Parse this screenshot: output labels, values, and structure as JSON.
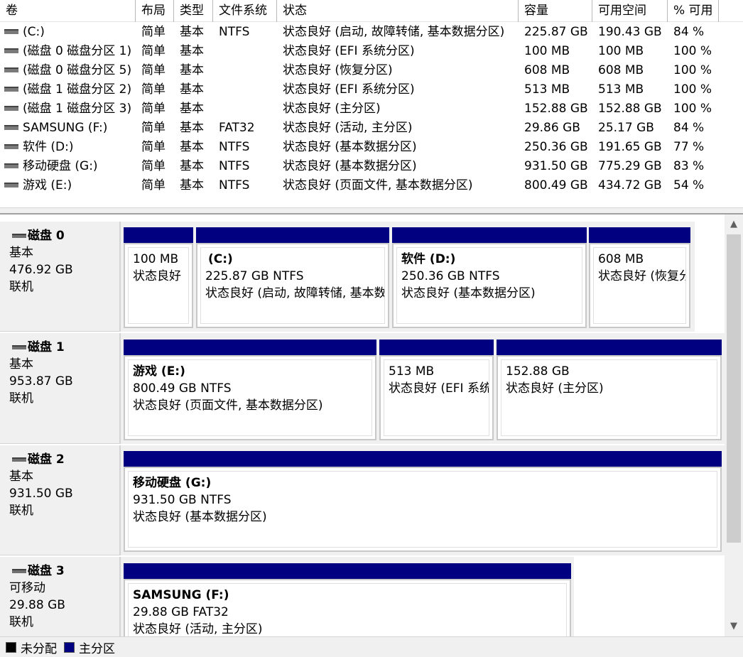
{
  "volume_list": {
    "columns": [
      "卷",
      "布局",
      "类型",
      "文件系统",
      "状态",
      "容量",
      "可用空间",
      "% 可用"
    ],
    "rows": [
      {
        "volume": "(C:)",
        "layout": "简单",
        "type": "基本",
        "fs": "NTFS",
        "status": "状态良好 (启动, 故障转储, 基本数据分区)",
        "capacity": "225.87 GB",
        "free": "190.43 GB",
        "pct": "84 %"
      },
      {
        "volume": "(磁盘 0 磁盘分区 1)",
        "layout": "简单",
        "type": "基本",
        "fs": "",
        "status": "状态良好 (EFI 系统分区)",
        "capacity": "100 MB",
        "free": "100 MB",
        "pct": "100 %"
      },
      {
        "volume": "(磁盘 0 磁盘分区 5)",
        "layout": "简单",
        "type": "基本",
        "fs": "",
        "status": "状态良好 (恢复分区)",
        "capacity": "608 MB",
        "free": "608 MB",
        "pct": "100 %"
      },
      {
        "volume": "(磁盘 1 磁盘分区 2)",
        "layout": "简单",
        "type": "基本",
        "fs": "",
        "status": "状态良好 (EFI 系统分区)",
        "capacity": "513 MB",
        "free": "513 MB",
        "pct": "100 %"
      },
      {
        "volume": "(磁盘 1 磁盘分区 3)",
        "layout": "简单",
        "type": "基本",
        "fs": "",
        "status": "状态良好 (主分区)",
        "capacity": "152.88 GB",
        "free": "152.88 GB",
        "pct": "100 %"
      },
      {
        "volume": "SAMSUNG (F:)",
        "layout": "简单",
        "type": "基本",
        "fs": "FAT32",
        "status": "状态良好 (活动, 主分区)",
        "capacity": "29.86 GB",
        "free": "25.17 GB",
        "pct": "84 %"
      },
      {
        "volume": "软件 (D:)",
        "layout": "简单",
        "type": "基本",
        "fs": "NTFS",
        "status": "状态良好 (基本数据分区)",
        "capacity": "250.36 GB",
        "free": "191.65 GB",
        "pct": "77 %"
      },
      {
        "volume": "移动硬盘 (G:)",
        "layout": "简单",
        "type": "基本",
        "fs": "NTFS",
        "status": "状态良好 (基本数据分区)",
        "capacity": "931.50 GB",
        "free": "775.29 GB",
        "pct": "83 %"
      },
      {
        "volume": "游戏 (E:)",
        "layout": "简单",
        "type": "基本",
        "fs": "NTFS",
        "status": "状态良好 (页面文件, 基本数据分区)",
        "capacity": "800.49 GB",
        "free": "434.72 GB",
        "pct": "54 %"
      }
    ]
  },
  "disks": [
    {
      "name": "磁盘 0",
      "kind": "基本",
      "size": "476.92 GB",
      "state": "联机",
      "partitions": [
        {
          "title": "",
          "size_fs": "100 MB",
          "status": "状态良好"
        },
        {
          "title": "(C:)",
          "size_fs": "225.87 GB NTFS",
          "status": "状态良好 (启动, 故障转储, 基本数据分区)"
        },
        {
          "title": "软件  (D:)",
          "size_fs": "250.36 GB NTFS",
          "status": "状态良好 (基本数据分区)"
        },
        {
          "title": "",
          "size_fs": "608 MB",
          "status": "状态良好 (恢复分区)"
        }
      ]
    },
    {
      "name": "磁盘 1",
      "kind": "基本",
      "size": "953.87 GB",
      "state": "联机",
      "partitions": [
        {
          "title": "游戏  (E:)",
          "size_fs": "800.49 GB NTFS",
          "status": "状态良好 (页面文件, 基本数据分区)"
        },
        {
          "title": "",
          "size_fs": "513 MB",
          "status": "状态良好 (EFI 系统分区)"
        },
        {
          "title": "",
          "size_fs": "152.88 GB",
          "status": "状态良好 (主分区)"
        }
      ]
    },
    {
      "name": "磁盘 2",
      "kind": "基本",
      "size": "931.50 GB",
      "state": "联机",
      "partitions": [
        {
          "title": "移动硬盘  (G:)",
          "size_fs": "931.50 GB NTFS",
          "status": "状态良好 (基本数据分区)"
        }
      ]
    },
    {
      "name": "磁盘 3",
      "kind": "可移动",
      "size": "29.88 GB",
      "state": "联机",
      "partitions": [
        {
          "title": "SAMSUNG  (F:)",
          "size_fs": "29.88 GB FAT32",
          "status": "状态良好 (活动, 主分区)"
        }
      ]
    }
  ],
  "legend": [
    {
      "label": "未分配",
      "color": "#000000"
    },
    {
      "label": "主分区",
      "color": "#000080"
    }
  ],
  "colors": {
    "primary_partition": "#000080",
    "unallocated": "#000000"
  }
}
